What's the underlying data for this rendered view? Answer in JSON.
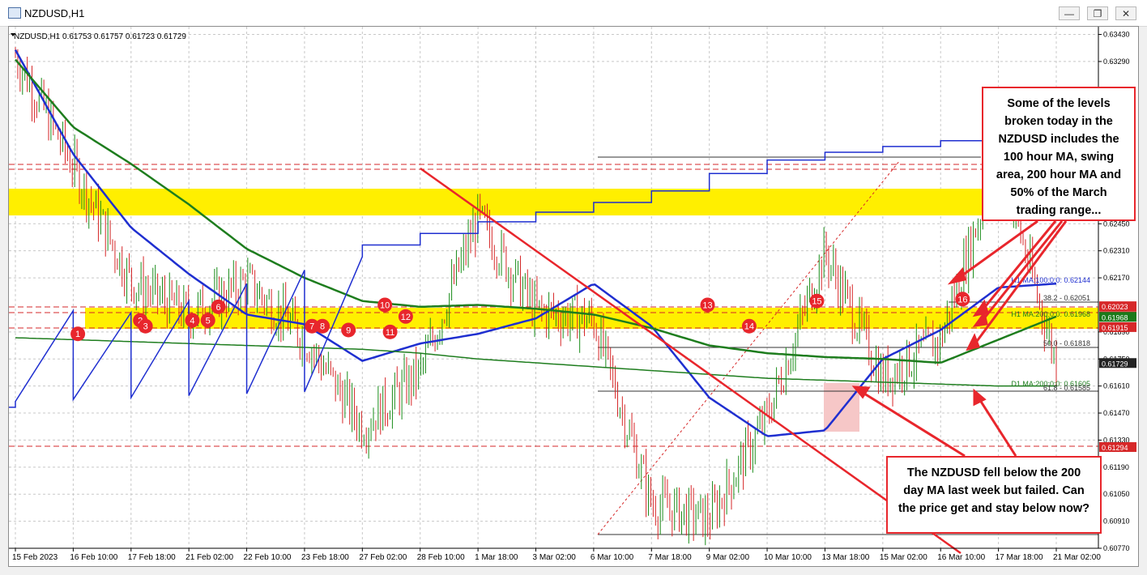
{
  "window": {
    "title": "NZDUSD,H1",
    "buttons": [
      "minimize",
      "restore",
      "close"
    ]
  },
  "chart": {
    "header": "NZDUSD,H1  0.61753 0.61757 0.61723 0.61729",
    "price_labels": [
      "0.63430",
      "0.63290",
      "0.62450",
      "0.62310",
      "0.62170",
      "0.61890",
      "0.61750",
      "0.61610",
      "0.61470",
      "0.61330",
      "0.61190",
      "0.61050",
      "0.60910",
      "0.60770"
    ],
    "time_labels": [
      "15 Feb 2023",
      "16 Feb 10:00",
      "17 Feb 18:00",
      "21 Feb 02:00",
      "22 Feb 10:00",
      "23 Feb 18:00",
      "27 Feb 02:00",
      "28 Feb 10:00",
      "1 Mar 18:00",
      "3 Mar 02:00",
      "6 Mar 10:00",
      "7 Mar 18:00",
      "9 Mar 02:00",
      "10 Mar 10:00",
      "13 Mar 18:00",
      "15 Mar 02:00",
      "16 Mar 10:00",
      "17 Mar 18:00",
      "21 Mar 02:00"
    ],
    "level_tags": [
      {
        "text": "0.62023",
        "color": "#d62728"
      },
      {
        "text": "0.61972",
        "color": "#d62728"
      },
      {
        "text": "0.61968",
        "color": "#1a7a1a"
      },
      {
        "text": "0.61915",
        "color": "#d62728"
      },
      {
        "text": "0.61729",
        "color": "#222222"
      },
      {
        "text": "0.61294",
        "color": "#d62728"
      }
    ],
    "level_texts": {
      "ma100": "H1 MA:100:0:0: 0.62144",
      "fib382": "38.2 - 0.62051",
      "ma200h": "H1 MA:200:0:0: 0.61968",
      "fib50": "50.0 - 0.61818",
      "ma200d": "D1 MA:200:0:0: 0.61605",
      "fib618": "61.8 - 0.61585"
    },
    "markers": [
      "1",
      "2",
      "3",
      "4",
      "5",
      "6",
      "7",
      "8",
      "9",
      "10",
      "11",
      "12",
      "13",
      "14",
      "15",
      "16"
    ],
    "colors": {
      "ma100": "#1f2fd0",
      "ma200": "#1e7d1e",
      "accent": "#e8262c",
      "zone": "#ffef00",
      "bull": "#1a8c1a",
      "bear": "#d62728"
    }
  },
  "chart_data": {
    "type": "line",
    "title": "NZDUSD,H1",
    "ohlc_last": {
      "open": 0.61753,
      "high": 0.61757,
      "low": 0.61723,
      "close": 0.61729
    },
    "ylim": [
      0.6077,
      0.6347
    ],
    "x": [
      "15 Feb 2023",
      "16 Feb 10:00",
      "17 Feb 18:00",
      "21 Feb 02:00",
      "22 Feb 10:00",
      "23 Feb 18:00",
      "27 Feb 02:00",
      "28 Feb 10:00",
      "1 Mar 18:00",
      "3 Mar 02:00",
      "6 Mar 10:00",
      "7 Mar 18:00",
      "9 Mar 02:00",
      "10 Mar 10:00",
      "13 Mar 18:00",
      "15 Mar 02:00",
      "16 Mar 10:00",
      "17 Mar 18:00",
      "21 Mar 02:00"
    ],
    "series": [
      {
        "name": "H1 MA:100",
        "values": [
          0.6335,
          0.6281,
          0.6243,
          0.6219,
          0.6198,
          0.6193,
          0.6174,
          0.6183,
          0.6188,
          0.6196,
          0.6214,
          0.6192,
          0.6155,
          0.6135,
          0.6138,
          0.6175,
          0.619,
          0.6212,
          0.6214
        ]
      },
      {
        "name": "H1 MA:200",
        "values": [
          0.633,
          0.6295,
          0.6276,
          0.6255,
          0.6232,
          0.6217,
          0.6205,
          0.6202,
          0.6203,
          0.6201,
          0.6198,
          0.6191,
          0.6182,
          0.6178,
          0.6176,
          0.6175,
          0.6173,
          0.6185,
          0.6197
        ]
      },
      {
        "name": "D1 MA:200",
        "values": [
          0.6186,
          0.6185,
          0.6184,
          0.6183,
          0.6182,
          0.6181,
          0.618,
          0.6178,
          0.6175,
          0.6173,
          0.6171,
          0.6169,
          0.6167,
          0.6165,
          0.6164,
          0.6163,
          0.6162,
          0.6161,
          0.6161
        ]
      },
      {
        "name": "Close",
        "values": [
          0.6332,
          0.6275,
          0.6215,
          0.6198,
          0.6215,
          0.6186,
          0.614,
          0.6168,
          0.6248,
          0.62,
          0.6195,
          0.61,
          0.6092,
          0.6145,
          0.623,
          0.6165,
          0.6185,
          0.628,
          0.6173
        ]
      }
    ],
    "levels": [
      {
        "label": "H1 MA:100:0:0:",
        "value": 0.62144
      },
      {
        "label": "38.2",
        "value": 0.62051
      },
      {
        "label": "H1 MA:200:0:0:",
        "value": 0.61968
      },
      {
        "label": "50.0",
        "value": 0.61818
      },
      {
        "label": "D1 MA:200:0:0:",
        "value": 0.61605
      },
      {
        "label": "61.8",
        "value": 0.61585
      },
      {
        "label": "",
        "value": 0.62023
      },
      {
        "label": "",
        "value": 0.61972
      },
      {
        "label": "",
        "value": 0.61915
      },
      {
        "label": "",
        "value": 0.61294
      }
    ],
    "annotations": [
      "Some of the levels broken today in the NZDUSD includes the 100 hour MA, swing area, 200 hour MA and 50% of the March trading range...",
      "The NZDUSD fell below the 200 day MA last week but failed. Can the price get and stay below now?"
    ]
  }
}
